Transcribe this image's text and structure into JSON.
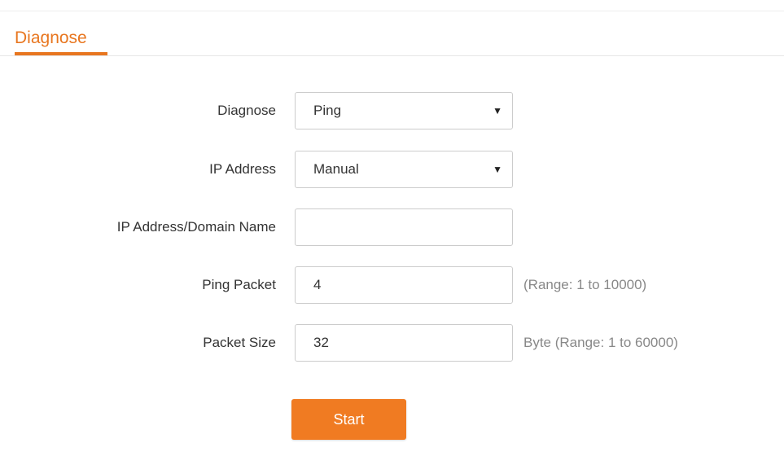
{
  "section": {
    "title": "Diagnose"
  },
  "form": {
    "diagnose": {
      "label": "Diagnose",
      "value": "Ping"
    },
    "ip_address": {
      "label": "IP Address",
      "value": "Manual"
    },
    "domain": {
      "label": "IP Address/Domain Name",
      "value": ""
    },
    "ping_packet": {
      "label": "Ping Packet",
      "value": "4",
      "hint": "(Range: 1 to 10000)"
    },
    "packet_size": {
      "label": "Packet Size",
      "value": "32",
      "hint": "Byte (Range: 1 to 60000)"
    }
  },
  "actions": {
    "start_label": "Start"
  },
  "colors": {
    "accent": "#e8761f",
    "button": "#f07b22"
  }
}
